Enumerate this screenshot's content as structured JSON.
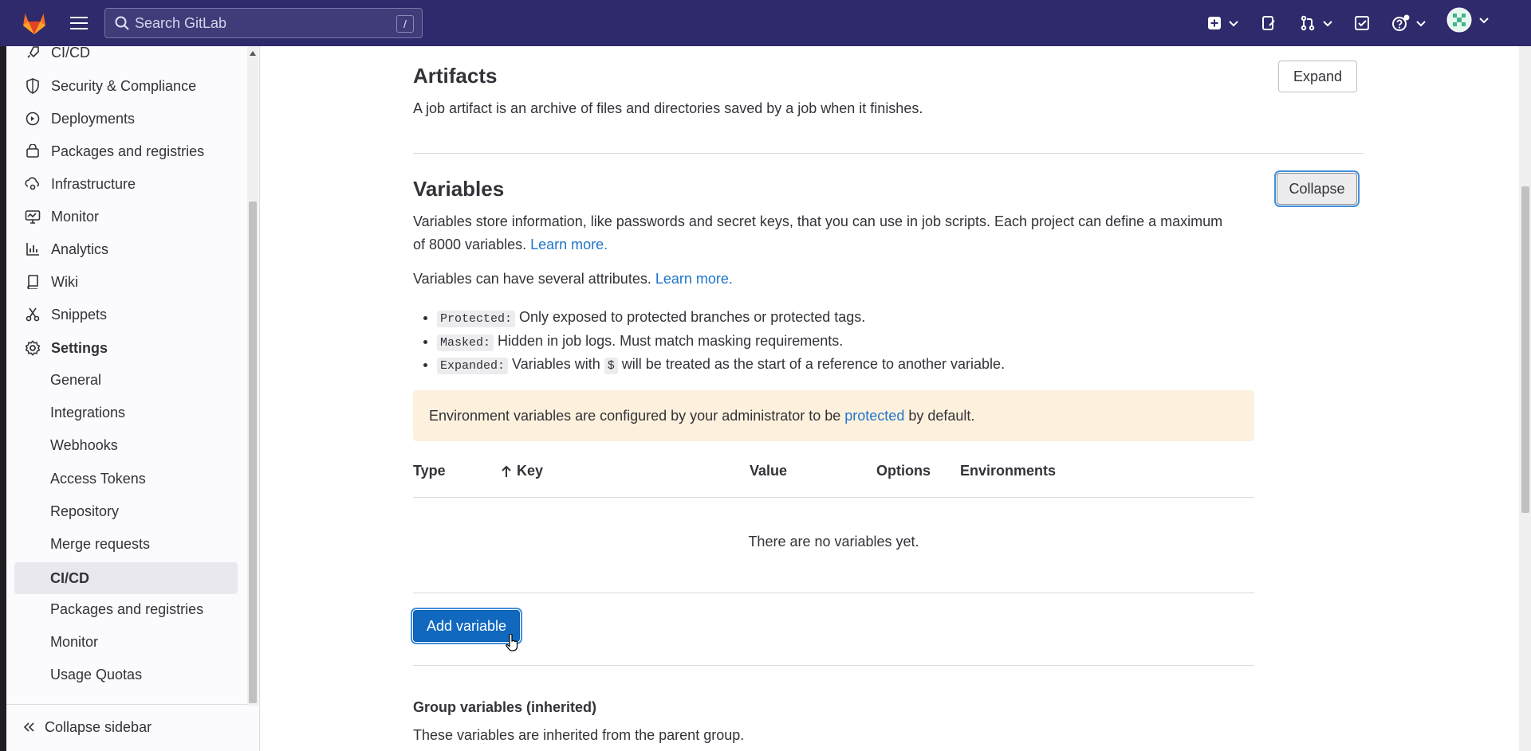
{
  "topbar": {
    "search_placeholder": "Search GitLab",
    "search_shortcut": "/"
  },
  "sidebar": {
    "items": [
      {
        "label": "CI/CD",
        "icon": "rocket-icon"
      },
      {
        "label": "Security & Compliance",
        "icon": "shield-icon"
      },
      {
        "label": "Deployments",
        "icon": "deployments-icon"
      },
      {
        "label": "Packages and registries",
        "icon": "package-icon"
      },
      {
        "label": "Infrastructure",
        "icon": "cloud-gear-icon"
      },
      {
        "label": "Monitor",
        "icon": "monitor-icon"
      },
      {
        "label": "Analytics",
        "icon": "chart-icon"
      },
      {
        "label": "Wiki",
        "icon": "book-icon"
      },
      {
        "label": "Snippets",
        "icon": "scissors-icon"
      },
      {
        "label": "Settings",
        "icon": "gear-icon"
      }
    ],
    "settings_sub": [
      {
        "label": "General"
      },
      {
        "label": "Integrations"
      },
      {
        "label": "Webhooks"
      },
      {
        "label": "Access Tokens"
      },
      {
        "label": "Repository"
      },
      {
        "label": "Merge requests"
      },
      {
        "label": "CI/CD",
        "active": true
      },
      {
        "label": "Packages and registries"
      },
      {
        "label": "Monitor"
      },
      {
        "label": "Usage Quotas"
      }
    ],
    "collapse_label": "Collapse sidebar"
  },
  "artifacts": {
    "title": "Artifacts",
    "description": "A job artifact is an archive of files and directories saved by a job when it finishes.",
    "expand_label": "Expand"
  },
  "variables": {
    "title": "Variables",
    "collapse_label": "Collapse",
    "desc_line1": "Variables store information, like passwords and secret keys, that you can use in job scripts. Each project can define a maximum",
    "desc_line2": "of 8000 variables.",
    "learn_more": "Learn more.",
    "attributes_text": "Variables can have several attributes.",
    "attributes_learn_more": "Learn more.",
    "bullets": [
      {
        "code": "Protected:",
        "text": "Only exposed to protected branches or protected tags."
      },
      {
        "code": "Masked:",
        "text": "Hidden in job logs. Must match masking requirements."
      },
      {
        "code": "Expanded:",
        "text_before": "Variables with",
        "code2": "$",
        "text_after": "will be treated as the start of a reference to another variable."
      }
    ],
    "alert_before": "Environment variables are configured by your administrator to be",
    "alert_link": "protected",
    "alert_after": "by default.",
    "table_headers": {
      "type": "Type",
      "key": "Key",
      "key_sort_icon": "arrow-up-icon",
      "value": "Value",
      "options": "Options",
      "environments": "Environments"
    },
    "empty_text": "There are no variables yet.",
    "add_button": "Add variable"
  },
  "group_variables": {
    "title": "Group variables (inherited)",
    "description": "These variables are inherited from the parent group."
  },
  "colors": {
    "topbar": "#2f2a6b",
    "link": "#1f75cb",
    "primary_button": "#1068bf",
    "alert_bg": "#fdf1dd"
  }
}
